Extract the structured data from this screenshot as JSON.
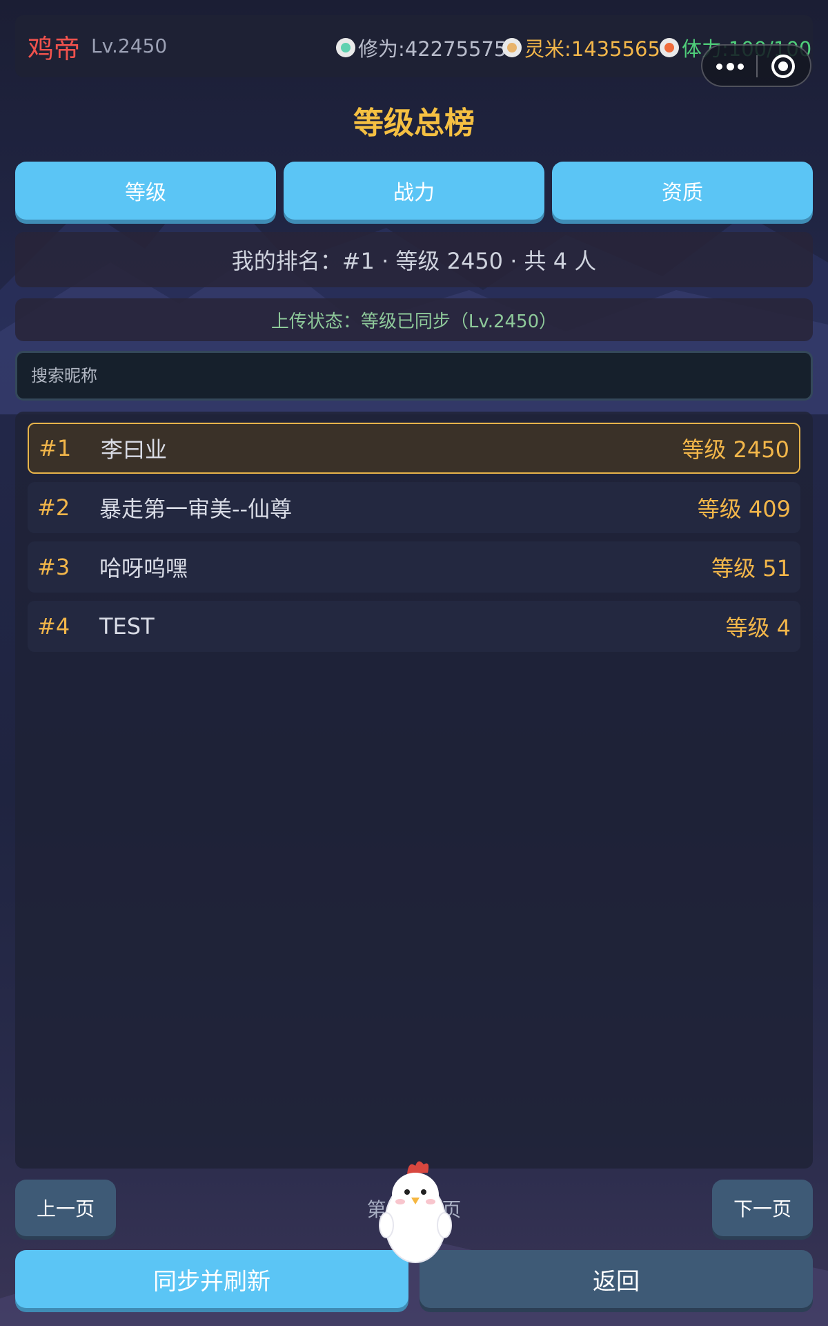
{
  "header": {
    "player_name": "鸡帝",
    "player_level": "Lv.2450",
    "xiuwei": "修为:42275575",
    "lingmi": "灵米:1435565",
    "tili": "体力:100/100"
  },
  "page_title": "等级总榜",
  "tabs": [
    {
      "label": "等级"
    },
    {
      "label": "战力"
    },
    {
      "label": "资质"
    }
  ],
  "my_rank": "我的排名：#1 · 等级 2450 · 共 4 人",
  "upload_status": "上传状态：等级已同步（Lv.2450）",
  "search": {
    "placeholder": "搜索昵称",
    "value": ""
  },
  "rows": [
    {
      "rank": "#1",
      "name": "李曰业",
      "score": "等级 2450",
      "is_mine": true
    },
    {
      "rank": "#2",
      "name": "暴走第一审美--仙尊",
      "score": "等级 409",
      "is_mine": false
    },
    {
      "rank": "#3",
      "name": "哈呀呜嘿",
      "score": "等级 51",
      "is_mine": false
    },
    {
      "rank": "#4",
      "name": "TEST",
      "score": "等级 4",
      "is_mine": false
    }
  ],
  "pagination": {
    "prev_label": "上一页",
    "next_label": "下一页",
    "indicator": "第 1 / 1 页"
  },
  "actions": {
    "sync_label": "同步并刷新",
    "back_label": "返回"
  },
  "colors": {
    "accent_blue": "#5bc5f5",
    "gold": "#f2b64a",
    "name_red": "#f0524d",
    "stamina_green": "#4fcf7a"
  },
  "icons": [
    "xiuwei-orb-icon",
    "lingmi-rice-icon",
    "tili-flame-icon",
    "more-icon",
    "close-target-icon",
    "chicken-mascot"
  ]
}
